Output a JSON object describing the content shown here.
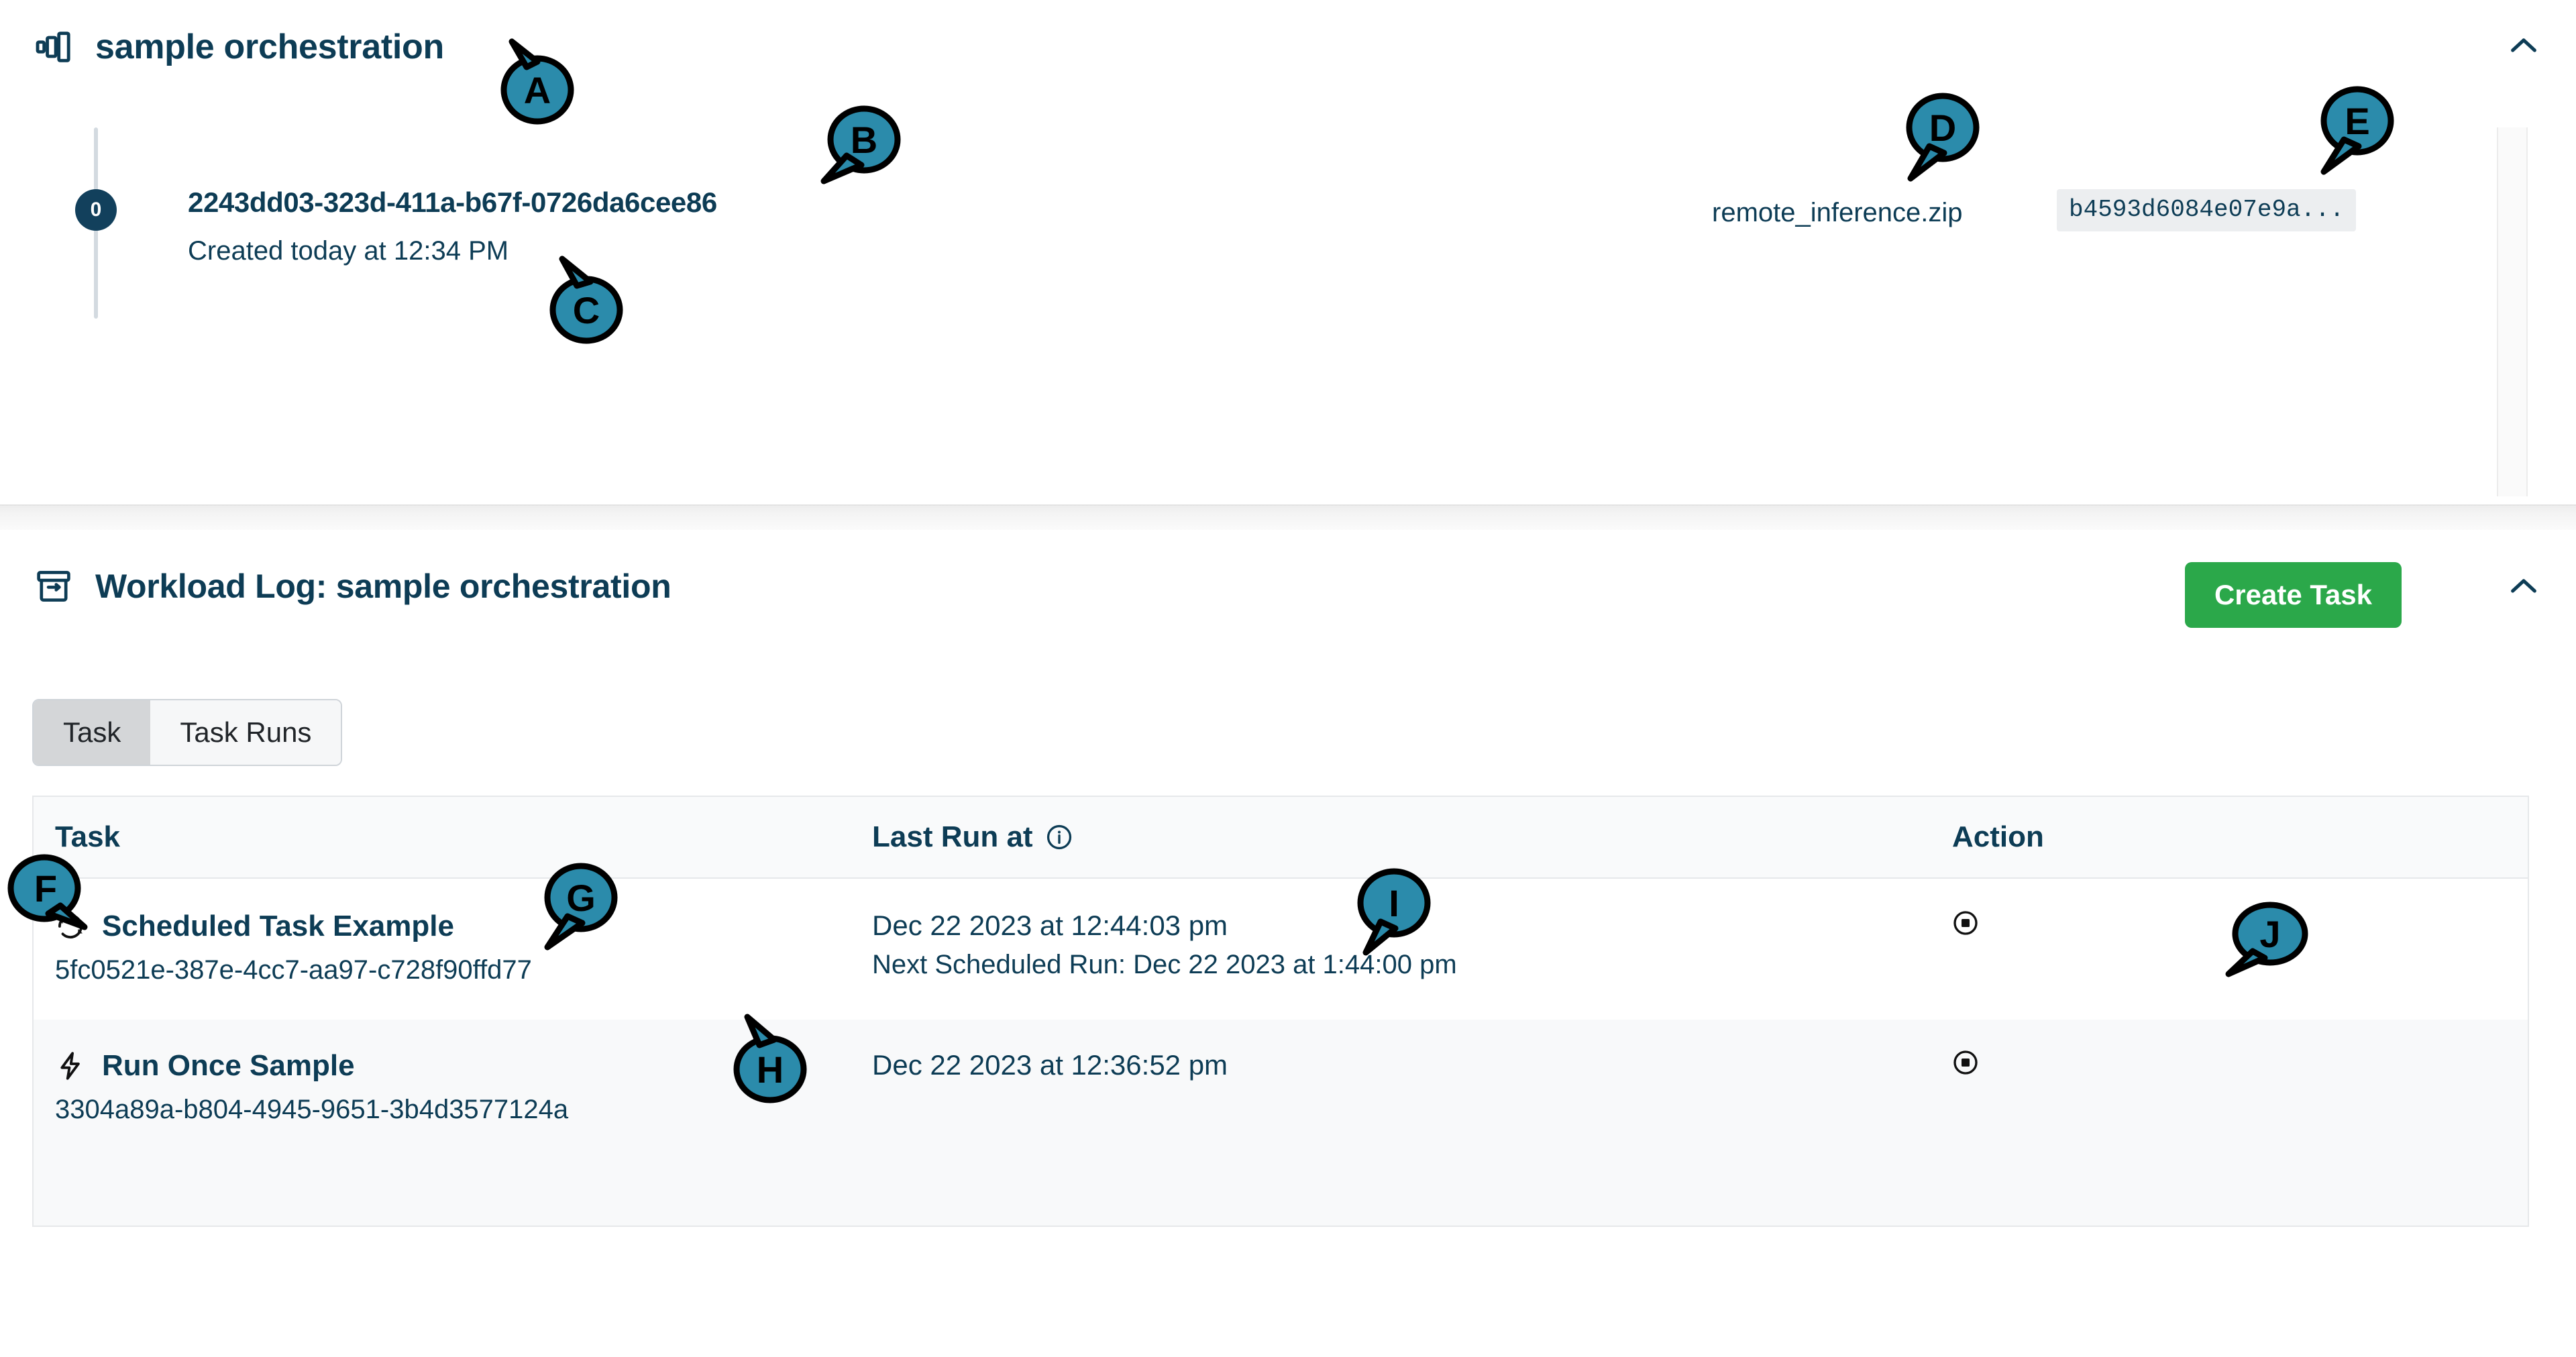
{
  "orchestration": {
    "icon": "columns-icon",
    "title": "sample orchestration",
    "collapse_icon": "chevron-up-icon",
    "run": {
      "index_label": "0",
      "uuid": "2243dd03-323d-411a-b67f-0726da6cee86",
      "created": "Created today at 12:34 PM",
      "artifact_name": "remote_inference.zip",
      "artifact_hash": "b4593d6084e07e9a..."
    }
  },
  "workload_log": {
    "icon": "archive-box-icon",
    "title": "Workload Log: sample orchestration",
    "create_button": "Create Task",
    "collapse_icon": "chevron-up-icon",
    "tabs": [
      {
        "label": "Task",
        "active": true
      },
      {
        "label": "Task Runs",
        "active": false
      }
    ],
    "table": {
      "columns": [
        "Task",
        "Last Run at",
        "Action"
      ],
      "last_run_info_icon": "info-circle-icon",
      "rows": [
        {
          "icon": "refresh-icon",
          "name": "Scheduled Task Example",
          "id": "5fc0521e-387e-4cc7-aa97-c728f90ffd77",
          "last_run": "Dec 22 2023 at 12:44:03 pm",
          "next_run": "Next Scheduled Run: Dec 22 2023 at 1:44:00 pm",
          "action_icon": "stop-circle-icon"
        },
        {
          "icon": "lightning-bolt-icon",
          "name": "Run Once Sample",
          "id": "3304a89a-b804-4945-9651-3b4d3577124a",
          "last_run": "Dec 22 2023 at 12:36:52 pm",
          "next_run": "",
          "action_icon": "stop-circle-icon"
        }
      ]
    }
  },
  "annotations": [
    {
      "letter": "A",
      "target": "orchestration-title"
    },
    {
      "letter": "B",
      "target": "run-uuid"
    },
    {
      "letter": "C",
      "target": "run-created-date"
    },
    {
      "letter": "D",
      "target": "artifact-name"
    },
    {
      "letter": "E",
      "target": "artifact-hash"
    },
    {
      "letter": "F",
      "target": "task-column-header"
    },
    {
      "letter": "G",
      "target": "task-name-row-1"
    },
    {
      "letter": "H",
      "target": "task-id-row-1"
    },
    {
      "letter": "I",
      "target": "last-run-row-1"
    },
    {
      "letter": "J",
      "target": "action-stop-row-1"
    }
  ],
  "colors": {
    "navy": "#0d3c55",
    "green": "#2ba84a",
    "bubble": "#2b8bab",
    "row_alt": "#f8f9fa"
  }
}
